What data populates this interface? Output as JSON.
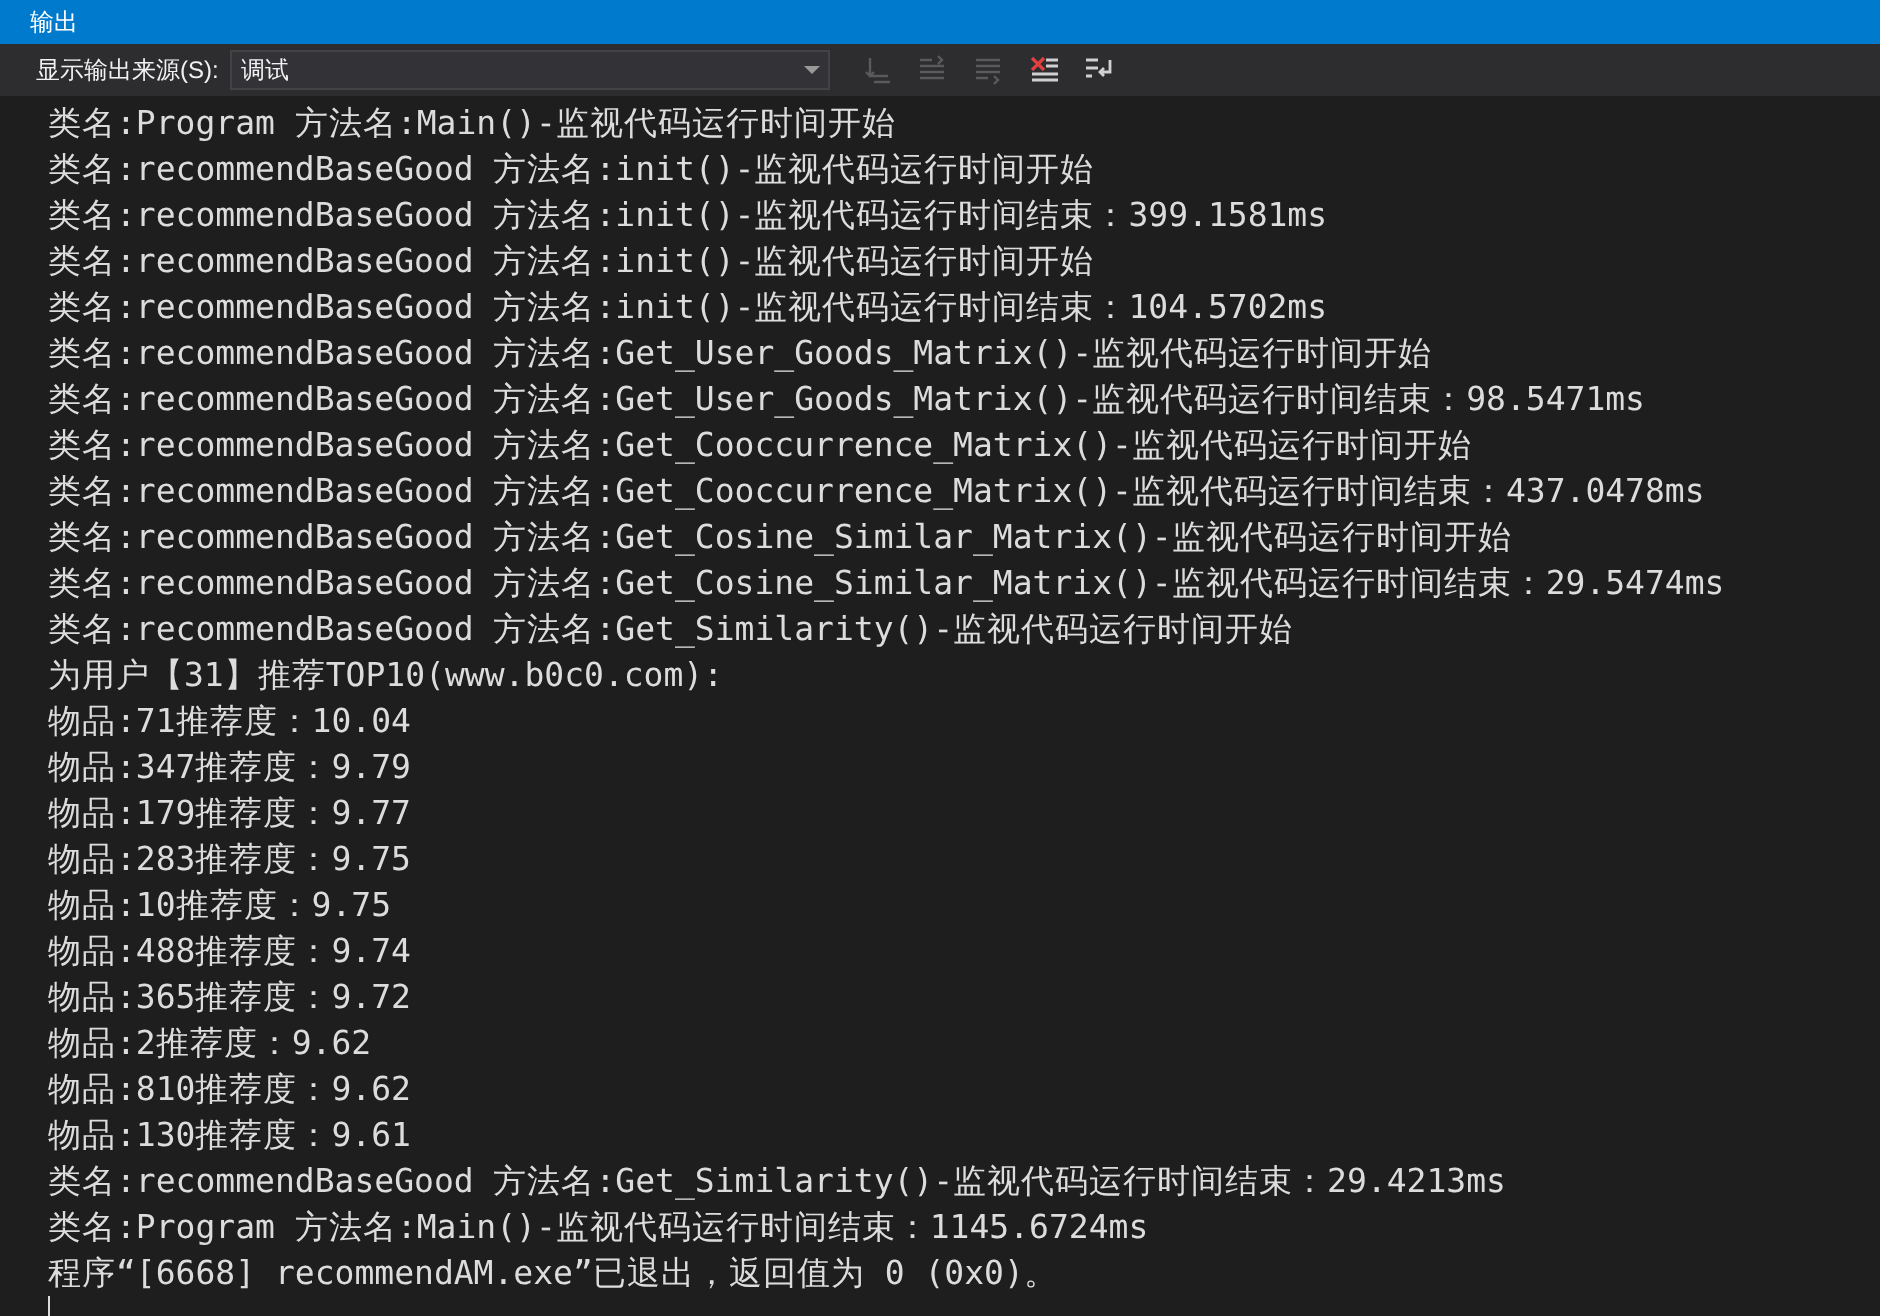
{
  "window": {
    "title": "输出"
  },
  "toolbar": {
    "source_label": "显示输出来源(S):",
    "source_value": "调试",
    "buttons": [
      {
        "kind": "goto",
        "disabled": true
      },
      {
        "kind": "prev",
        "disabled": true
      },
      {
        "kind": "next",
        "disabled": true
      },
      {
        "kind": "clear",
        "disabled": false
      },
      {
        "kind": "wrap",
        "disabled": false
      }
    ]
  },
  "output_lines": [
    "类名:Program 方法名:Main()-监视代码运行时间开始",
    "类名:recommendBaseGood 方法名:init()-监视代码运行时间开始",
    "类名:recommendBaseGood 方法名:init()-监视代码运行时间结束：399.1581ms",
    "类名:recommendBaseGood 方法名:init()-监视代码运行时间开始",
    "类名:recommendBaseGood 方法名:init()-监视代码运行时间结束：104.5702ms",
    "类名:recommendBaseGood 方法名:Get_User_Goods_Matrix()-监视代码运行时间开始",
    "类名:recommendBaseGood 方法名:Get_User_Goods_Matrix()-监视代码运行时间结束：98.5471ms",
    "类名:recommendBaseGood 方法名:Get_Cooccurrence_Matrix()-监视代码运行时间开始",
    "类名:recommendBaseGood 方法名:Get_Cooccurrence_Matrix()-监视代码运行时间结束：437.0478ms",
    "类名:recommendBaseGood 方法名:Get_Cosine_Similar_Matrix()-监视代码运行时间开始",
    "类名:recommendBaseGood 方法名:Get_Cosine_Similar_Matrix()-监视代码运行时间结束：29.5474ms",
    "类名:recommendBaseGood 方法名:Get_Similarity()-监视代码运行时间开始",
    "为用户【31】推荐TOP10(www.b0c0.com):",
    "物品:71推荐度：10.04",
    "物品:347推荐度：9.79",
    "物品:179推荐度：9.77",
    "物品:283推荐度：9.75",
    "物品:10推荐度：9.75",
    "物品:488推荐度：9.74",
    "物品:365推荐度：9.72",
    "物品:2推荐度：9.62",
    "物品:810推荐度：9.62",
    "物品:130推荐度：9.61",
    "类名:recommendBaseGood 方法名:Get_Similarity()-监视代码运行时间结束：29.4213ms",
    "类名:Program 方法名:Main()-监视代码运行时间结束：1145.6724ms",
    "程序“[6668] recommendAM.exe”已退出，返回值为 0 (0x0)。"
  ]
}
